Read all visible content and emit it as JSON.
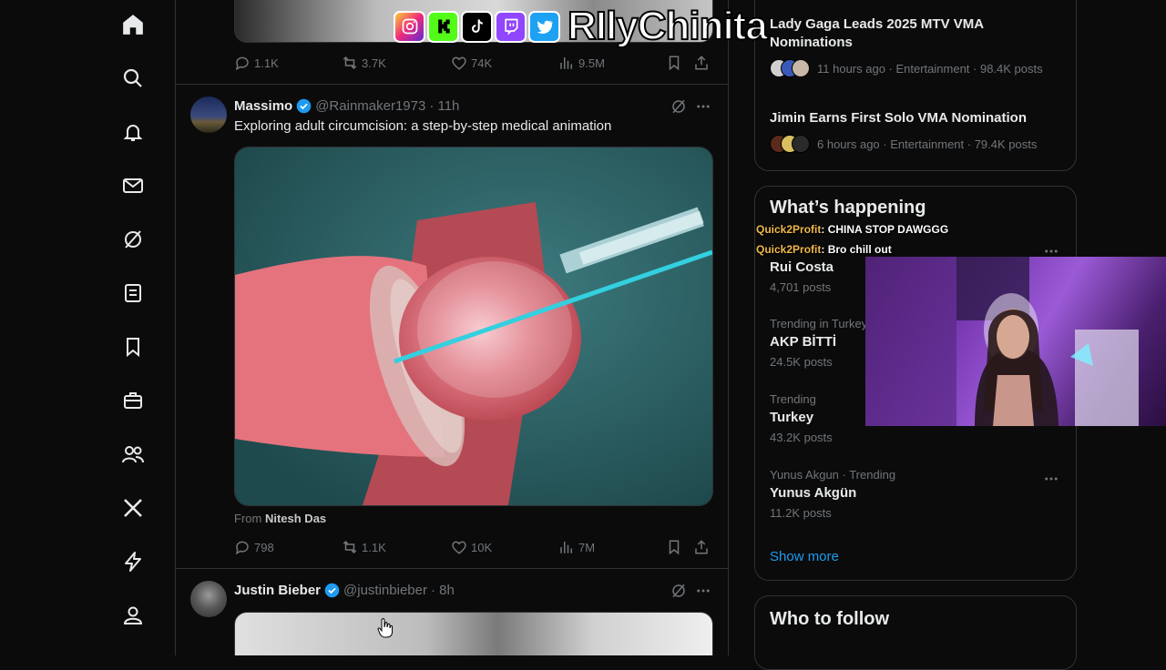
{
  "nav": {
    "items": [
      {
        "name": "nav-home",
        "icon": "home-icon"
      },
      {
        "name": "nav-explore",
        "icon": "search-icon"
      },
      {
        "name": "nav-notifications",
        "icon": "bell-icon"
      },
      {
        "name": "nav-messages",
        "icon": "mail-icon"
      },
      {
        "name": "nav-grok",
        "icon": "grok-icon"
      },
      {
        "name": "nav-lists",
        "icon": "list-icon"
      },
      {
        "name": "nav-bookmarks",
        "icon": "bookmark-icon"
      },
      {
        "name": "nav-jobs",
        "icon": "briefcase-icon"
      },
      {
        "name": "nav-communities",
        "icon": "people-icon"
      },
      {
        "name": "nav-premium",
        "icon": "x-logo-icon"
      },
      {
        "name": "nav-verified-orgs",
        "icon": "lightning-icon"
      },
      {
        "name": "nav-profile",
        "icon": "person-icon"
      }
    ]
  },
  "feed": {
    "prev_tweet": {
      "replies": "1.1K",
      "reposts": "3.7K",
      "likes": "74K",
      "views": "9.5M"
    },
    "tweet": {
      "name": "Massimo",
      "handle": "@Rainmaker1973",
      "time": "· 11h",
      "text": "Exploring adult circumcision: a step-by-step medical animation",
      "from_prefix": "From",
      "from_user": "Nitesh Das",
      "replies": "798",
      "reposts": "1.1K",
      "likes": "10K",
      "views": "7M"
    },
    "next_tweet": {
      "name": "Justin Bieber",
      "handle": "@justinbieber",
      "time": "· 8h"
    }
  },
  "sidebar": {
    "top_trends": [
      {
        "title": "Lady Gaga Leads 2025 MTV VMA Nominations",
        "meta": "11 hours ago · Entertainment · 98.4K posts"
      },
      {
        "title": "Jimin Earns First Solo VMA Nomination",
        "meta": "6 hours ago · Entertainment · 79.4K posts"
      }
    ],
    "whats_happening": {
      "title": "What’s happening",
      "trends": [
        {
          "context": "",
          "title": "Rui Costa",
          "count": "4,701 posts"
        },
        {
          "context": "Trending in Turkey",
          "title": "AKP BİTTİ",
          "count": "24.5K posts"
        },
        {
          "context": "Trending",
          "title": "Turkey",
          "count": "43.2K posts"
        },
        {
          "context": "Yunus Akgun · Trending",
          "title": "Yunus Akgün",
          "count": "11.2K posts"
        }
      ],
      "show_more": "Show more"
    },
    "who_to_follow": "Who to follow"
  },
  "overlay": {
    "streamer_name": "RIlyChinita",
    "socials": [
      "instagram-icon",
      "kick-icon",
      "tiktok-icon",
      "twitch-icon",
      "twitter-bird-icon"
    ],
    "chat": [
      {
        "user": "Quick2Profit",
        "message": ": CHINA STOP DAWGGG"
      },
      {
        "user": "Quick2Profit",
        "message": ": Bro chill out"
      }
    ]
  },
  "colors": {
    "background": "#0b0b0b",
    "accent": "#1d9bf0",
    "verified": "#1d9bf0",
    "muted": "#71767b",
    "chat_user": "#f0b84a"
  }
}
